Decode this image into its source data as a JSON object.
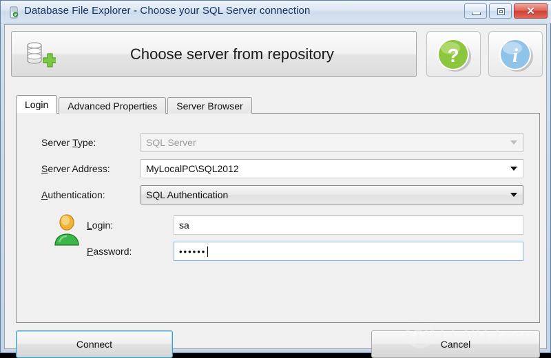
{
  "window": {
    "title": "Database File Explorer - Choose your SQL Server connection",
    "icon": "database-app-icon",
    "controls": {
      "minimize": "minimize-button",
      "maximize": "maximize-button",
      "close": "close-button",
      "close_glyph": "✕"
    }
  },
  "banner": {
    "title": "Choose server from repository",
    "icon": "database-add-icon",
    "help_icon": "question-mark-icon",
    "help_glyph": "?",
    "info_icon": "information-icon",
    "info_glyph": "i"
  },
  "tabs": [
    {
      "label": "Login",
      "active": true
    },
    {
      "label": "Advanced Properties",
      "active": false
    },
    {
      "label": "Server Browser",
      "active": false
    }
  ],
  "form": {
    "server_type": {
      "label": "Server Type:",
      "accel": "T",
      "label_pre": "Server ",
      "label_post": "ype:",
      "value": "SQL Server",
      "disabled": true
    },
    "server_address": {
      "label": "Server Address:",
      "accel": "S",
      "label_pre": "",
      "label_post": "erver Address:",
      "value": "MyLocalPC\\SQL2012",
      "disabled": false
    },
    "authentication": {
      "label": "Authentication:",
      "accel": "A",
      "label_pre": "",
      "label_post": "uthentication:",
      "value": "SQL Authentication",
      "disabled": false
    },
    "login": {
      "label": "Login:",
      "accel": "L",
      "label_pre": "",
      "label_post": "ogin:",
      "value": "sa",
      "placeholder": ""
    },
    "password": {
      "label": "Password:",
      "accel": "P",
      "label_pre": "",
      "label_post": "assword:",
      "value": "••••••",
      "masked_char_count": 6,
      "focused": true
    },
    "user_icon": "user-account-icon"
  },
  "footer": {
    "connect_label": "Connect",
    "cancel_label": "Cancel"
  },
  "watermark": {
    "text": "LO4D",
    "suffix": ".com",
    "logo_icon": "up-down-arrows-icon"
  },
  "colors": {
    "titlebar_text": "#14325c",
    "close_button": "#cf4236",
    "default_button_border": "#3c9dc4",
    "help_green": "#7dc242",
    "info_blue": "#7fb8e0"
  }
}
